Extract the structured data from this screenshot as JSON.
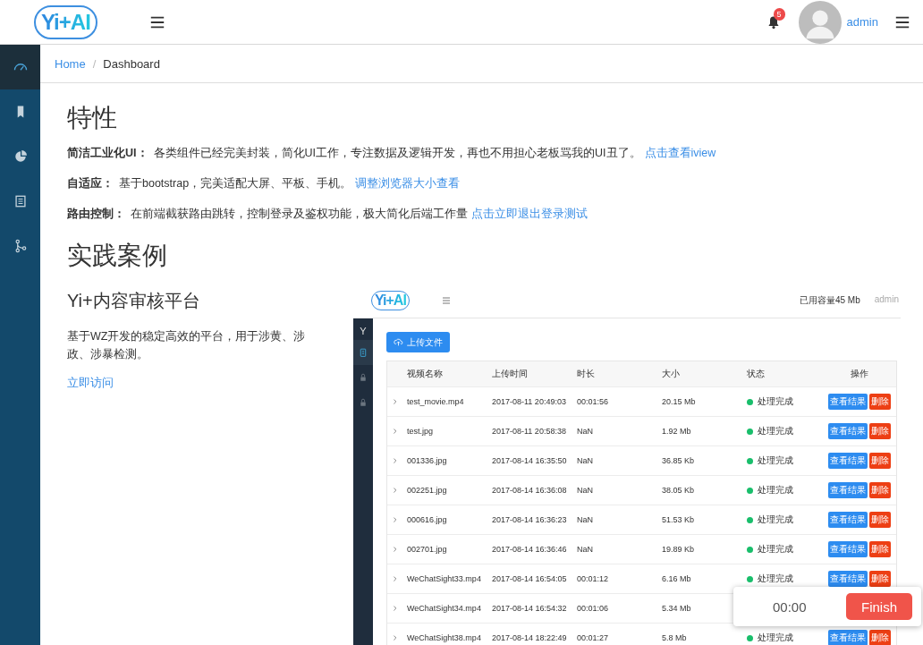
{
  "header": {
    "logo": "Yi+AI",
    "notification_count": "5",
    "user": "admin"
  },
  "sidebar": {
    "items": [
      {
        "kind": "gauge",
        "selected": true
      },
      {
        "kind": "bookmark",
        "selected": false
      },
      {
        "kind": "pie",
        "selected": false
      },
      {
        "kind": "document",
        "selected": false
      },
      {
        "kind": "branch",
        "selected": false
      }
    ]
  },
  "breadcrumb": {
    "separator": "/",
    "items": [
      {
        "label": "Home",
        "link": true
      },
      {
        "label": "Dashboard",
        "link": false
      }
    ]
  },
  "features": {
    "title": "特性",
    "items": [
      {
        "label": "简洁工业化UI：",
        "text": "各类组件已经完美封装，简化UI工作，专注数据及逻辑开发，再也不用担心老板骂我的UI丑了。",
        "link": "点击查看iview"
      },
      {
        "label": "自适应：",
        "text": "基于bootstrap，完美适配大屏、平板、手机。",
        "link": "调整浏览器大小查看"
      },
      {
        "label": "路由控制：",
        "text": "在前端截获路由跳转，控制登录及鉴权功能，极大简化后端工作量",
        "link": "点击立即退出登录测试"
      }
    ]
  },
  "cases": {
    "title": "实践案例",
    "case": {
      "title": "Yi+内容审核平台",
      "description": "基于WZ开发的稳定高效的平台，用于涉黄、涉政、涉暴检测。",
      "link": "立即访问"
    }
  },
  "preview": {
    "logo": "Yi+AI",
    "usage": "已用容量45 Mb",
    "user": "admin",
    "sidebar": {
      "logo": "Y",
      "items": [
        {
          "kind": "clipboard",
          "selected": true
        },
        {
          "kind": "lock",
          "selected": false
        },
        {
          "kind": "lock",
          "selected": false
        }
      ]
    },
    "upload_button": "上传文件",
    "table": {
      "columns": [
        "视频名称",
        "上传时间",
        "时长",
        "大小",
        "状态",
        "操作"
      ],
      "rows": [
        {
          "name": "test_movie.mp4",
          "time": "2017-08-11 20:49:03",
          "duration": "00:01:56",
          "size": "20.15 Mb",
          "status": "处理完成",
          "actions": [
            "查看结果",
            "删除"
          ]
        },
        {
          "name": "test.jpg",
          "time": "2017-08-11 20:58:38",
          "duration": "NaN",
          "size": "1.92 Mb",
          "status": "处理完成",
          "actions": [
            "查看结果",
            "删除"
          ]
        },
        {
          "name": "001336.jpg",
          "time": "2017-08-14 16:35:50",
          "duration": "NaN",
          "size": "36.85 Kb",
          "status": "处理完成",
          "actions": [
            "查看结果",
            "删除"
          ]
        },
        {
          "name": "002251.jpg",
          "time": "2017-08-14 16:36:08",
          "duration": "NaN",
          "size": "38.05 Kb",
          "status": "处理完成",
          "actions": [
            "查看结果",
            "删除"
          ]
        },
        {
          "name": "000616.jpg",
          "time": "2017-08-14 16:36:23",
          "duration": "NaN",
          "size": "51.53 Kb",
          "status": "处理完成",
          "actions": [
            "查看结果",
            "删除"
          ]
        },
        {
          "name": "002701.jpg",
          "time": "2017-08-14 16:36:46",
          "duration": "NaN",
          "size": "19.89 Kb",
          "status": "处理完成",
          "actions": [
            "查看结果",
            "删除"
          ]
        },
        {
          "name": "WeChatSight33.mp4",
          "time": "2017-08-14 16:54:05",
          "duration": "00:01:12",
          "size": "6.16 Mb",
          "status": "处理完成",
          "actions": [
            "查看结果",
            "删除"
          ]
        },
        {
          "name": "WeChatSight34.mp4",
          "time": "2017-08-14 16:54:32",
          "duration": "00:01:06",
          "size": "5.34 Mb"
        },
        {
          "name": "WeChatSight38.mp4",
          "time": "2017-08-14 18:22:49",
          "duration": "00:01:27",
          "size": "5.8 Mb",
          "status": "处理完成",
          "actions": [
            "查看结果",
            "删除"
          ]
        }
      ]
    }
  },
  "timer": {
    "time": "00:00",
    "button": "Finish"
  }
}
